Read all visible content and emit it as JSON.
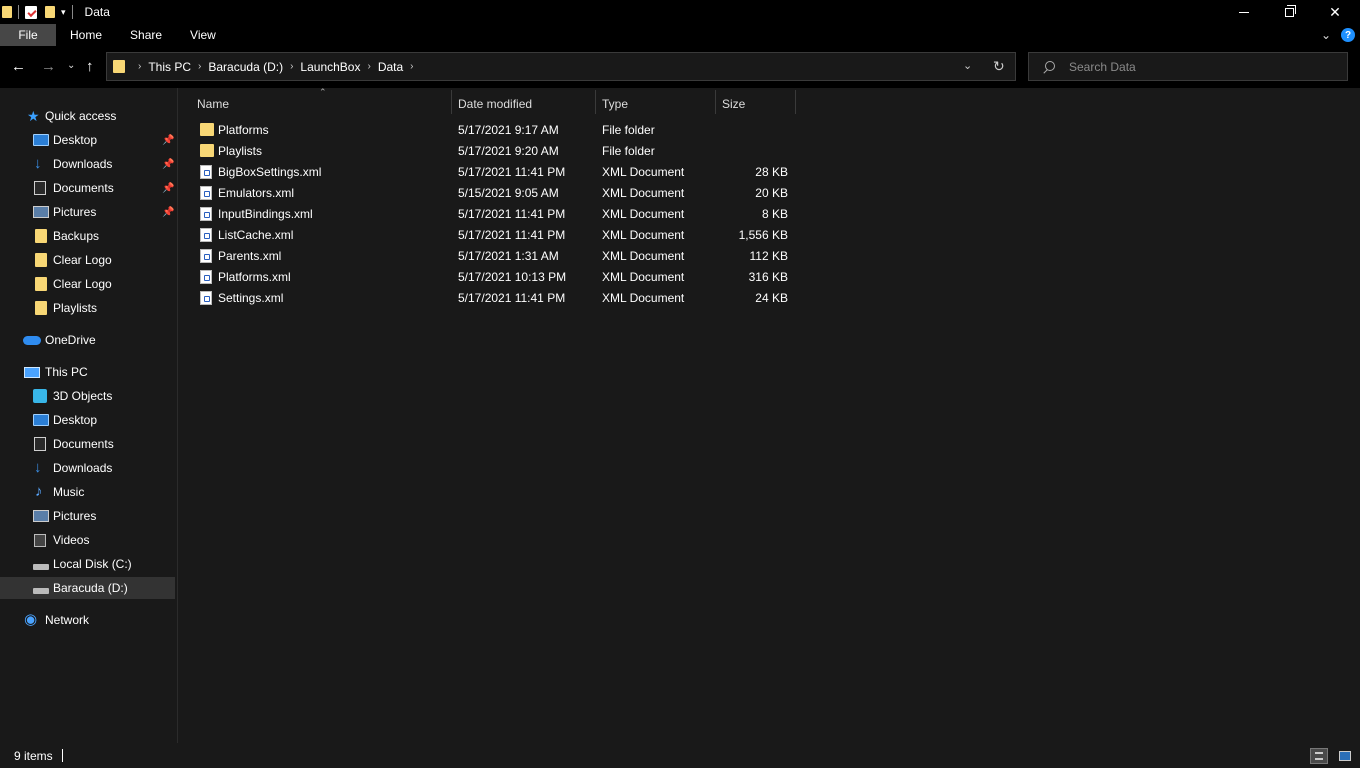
{
  "window": {
    "title": "Data",
    "minimize_icon": "minimize-icon",
    "maximize_icon": "restore-icon",
    "close_icon": "close-icon"
  },
  "ribbon": {
    "tabs": [
      {
        "label": "File"
      },
      {
        "label": "Home"
      },
      {
        "label": "Share"
      },
      {
        "label": "View"
      }
    ],
    "help_label": "?"
  },
  "navigation": {
    "breadcrumb": [
      "This PC",
      "Baracuda (D:)",
      "LaunchBox",
      "Data"
    ],
    "search_placeholder": "Search Data"
  },
  "sidebar": {
    "quick_access": {
      "label": "Quick access",
      "items": [
        {
          "label": "Desktop",
          "icon": "desktop-icon",
          "pinned": true
        },
        {
          "label": "Downloads",
          "icon": "downloads-icon",
          "pinned": true
        },
        {
          "label": "Documents",
          "icon": "documents-icon",
          "pinned": true
        },
        {
          "label": "Pictures",
          "icon": "pictures-icon",
          "pinned": true
        },
        {
          "label": "Backups",
          "icon": "folder-icon",
          "pinned": false
        },
        {
          "label": "Clear Logo",
          "icon": "folder-icon",
          "pinned": false
        },
        {
          "label": "Clear Logo",
          "icon": "folder-icon",
          "pinned": false
        },
        {
          "label": "Playlists",
          "icon": "folder-icon",
          "pinned": false
        }
      ]
    },
    "onedrive": {
      "label": "OneDrive"
    },
    "this_pc": {
      "label": "This PC",
      "items": [
        {
          "label": "3D Objects",
          "icon": "3d-objects-icon"
        },
        {
          "label": "Desktop",
          "icon": "desktop-icon"
        },
        {
          "label": "Documents",
          "icon": "documents-icon"
        },
        {
          "label": "Downloads",
          "icon": "downloads-icon"
        },
        {
          "label": "Music",
          "icon": "music-icon"
        },
        {
          "label": "Pictures",
          "icon": "pictures-icon"
        },
        {
          "label": "Videos",
          "icon": "videos-icon"
        },
        {
          "label": "Local Disk (C:)",
          "icon": "drive-icon"
        },
        {
          "label": "Baracuda (D:)",
          "icon": "drive-icon",
          "selected": true
        }
      ]
    },
    "network": {
      "label": "Network"
    }
  },
  "columns": {
    "name": "Name",
    "date": "Date modified",
    "type": "Type",
    "size": "Size"
  },
  "files": [
    {
      "name": "Platforms",
      "date": "5/17/2021 9:17 AM",
      "type": "File folder",
      "size": "",
      "icon": "folder-icon"
    },
    {
      "name": "Playlists",
      "date": "5/17/2021 9:20 AM",
      "type": "File folder",
      "size": "",
      "icon": "folder-icon"
    },
    {
      "name": "BigBoxSettings.xml",
      "date": "5/17/2021 11:41 PM",
      "type": "XML Document",
      "size": "28 KB",
      "icon": "xml-file-icon"
    },
    {
      "name": "Emulators.xml",
      "date": "5/15/2021 9:05 AM",
      "type": "XML Document",
      "size": "20 KB",
      "icon": "xml-file-icon"
    },
    {
      "name": "InputBindings.xml",
      "date": "5/17/2021 11:41 PM",
      "type": "XML Document",
      "size": "8 KB",
      "icon": "xml-file-icon"
    },
    {
      "name": "ListCache.xml",
      "date": "5/17/2021 11:41 PM",
      "type": "XML Document",
      "size": "1,556 KB",
      "icon": "xml-file-icon"
    },
    {
      "name": "Parents.xml",
      "date": "5/17/2021 1:31 AM",
      "type": "XML Document",
      "size": "112 KB",
      "icon": "xml-file-icon"
    },
    {
      "name": "Platforms.xml",
      "date": "5/17/2021 10:13 PM",
      "type": "XML Document",
      "size": "316 KB",
      "icon": "xml-file-icon"
    },
    {
      "name": "Settings.xml",
      "date": "5/17/2021 11:41 PM",
      "type": "XML Document",
      "size": "24 KB",
      "icon": "xml-file-icon"
    }
  ],
  "status": {
    "item_count": "9 items"
  },
  "colors": {
    "background": "#191919",
    "chrome": "#000000",
    "folder": "#f8d775",
    "accent": "#1e90ff",
    "selected": "#333333"
  }
}
